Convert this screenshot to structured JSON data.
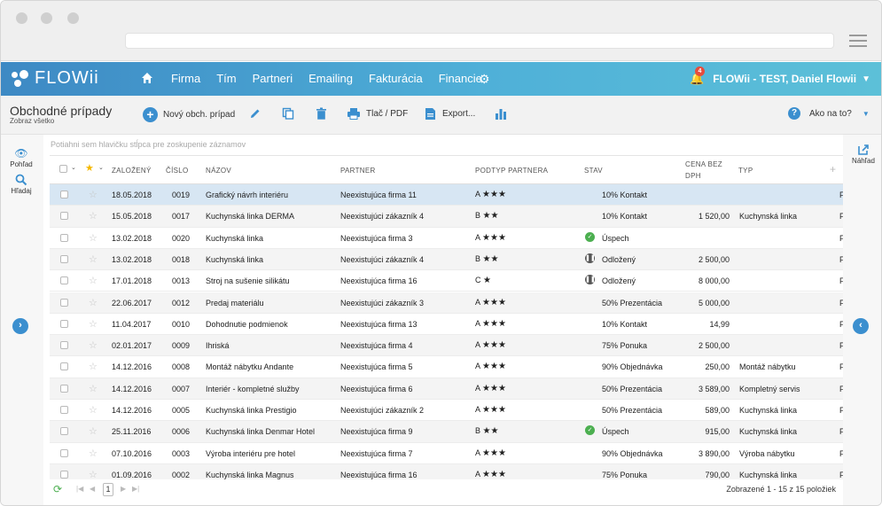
{
  "app": {
    "logo_text": "FLOWii",
    "nav_items": [
      "Firma",
      "Tím",
      "Partneri",
      "Emailing",
      "Fakturácia",
      "Financie"
    ],
    "notification_count": "4",
    "user_label": "FLOWii - TEST, Daniel Flowii",
    "brand_color": "#3d89c4"
  },
  "toolbar": {
    "title": "Obchodné prípady",
    "subtitle": "Zobraz všetko",
    "new_label": "Nový obch. prípad",
    "print_label": "Tlač / PDF",
    "export_label": "Export...",
    "help_label": "Ako na to?"
  },
  "left_panel": {
    "view_label": "Pohľad",
    "search_label": "Hľadaj"
  },
  "right_panel": {
    "preview_label": "Náhľad"
  },
  "grid": {
    "group_hint": "Potiahni sem hlavičku stĺpca pre zoskupenie záznamov",
    "headers": {
      "created": "ZALOŽENÝ",
      "number": "ČÍSLO",
      "name": "NÁZOV",
      "partner": "PARTNER",
      "subtype": "PODTYP PARTNERA",
      "status": "STAV",
      "price_1": "CENA BEZ",
      "price_2": "DPH",
      "type": "TYP"
    },
    "rows": [
      {
        "date": "18.05.2018",
        "num": "0019",
        "name": "Grafický návrh interiéru",
        "partner": "Neexistujúca firma 11",
        "grade": "A",
        "stars": "★★★",
        "state_icon": "",
        "state": "10% Kontakt",
        "price": "",
        "type": "",
        "selected": true
      },
      {
        "date": "15.05.2018",
        "num": "0017",
        "name": "Kuchynská linka DERMA",
        "partner": "Neexistujúci zákazník 4",
        "grade": "B",
        "stars": "★★",
        "state_icon": "",
        "state": "10% Kontakt",
        "price": "1 520,00",
        "type": "Kuchynská linka"
      },
      {
        "date": "13.02.2018",
        "num": "0020",
        "name": "Kuchynská linka",
        "partner": "Neexistujúca firma 3",
        "grade": "A",
        "stars": "★★★",
        "state_icon": "ok",
        "state": "Úspech",
        "price": "",
        "type": ""
      },
      {
        "date": "13.02.2018",
        "num": "0018",
        "name": "Kuchynská linka",
        "partner": "Neexistujúci zákazník 4",
        "grade": "B",
        "stars": "★★",
        "state_icon": "pause",
        "state": "Odložený",
        "price": "2 500,00",
        "type": ""
      },
      {
        "date": "17.01.2018",
        "num": "0013",
        "name": "Stroj na sušenie silikátu",
        "partner": "Neexistujúca firma 16",
        "grade": "C",
        "stars": "★",
        "state_icon": "pause",
        "state": "Odložený",
        "price": "8 000,00",
        "type": ""
      },
      {
        "date": "22.06.2017",
        "num": "0012",
        "name": "Predaj materiálu",
        "partner": "Neexistujúci zákazník 3",
        "grade": "A",
        "stars": "★★★",
        "state_icon": "",
        "state": "50% Prezentácia",
        "price": "5 000,00",
        "type": ""
      },
      {
        "date": "11.04.2017",
        "num": "0010",
        "name": "Dohodnutie podmienok",
        "partner": "Neexistujúca firma 13",
        "grade": "A",
        "stars": "★★★",
        "state_icon": "",
        "state": "10% Kontakt",
        "price": "14,99",
        "type": ""
      },
      {
        "date": "02.01.2017",
        "num": "0009",
        "name": "Ihriská",
        "partner": "Neexistujúca firma 4",
        "grade": "A",
        "stars": "★★★",
        "state_icon": "",
        "state": "75% Ponuka",
        "price": "2 500,00",
        "type": ""
      },
      {
        "date": "14.12.2016",
        "num": "0008",
        "name": "Montáž nábytku Andante",
        "partner": "Neexistujúca firma 5",
        "grade": "A",
        "stars": "★★★",
        "state_icon": "",
        "state": "90% Objednávka",
        "price": "250,00",
        "type": "Montáž nábytku"
      },
      {
        "date": "14.12.2016",
        "num": "0007",
        "name": "Interiér - kompletné služby",
        "partner": "Neexistujúca firma 6",
        "grade": "A",
        "stars": "★★★",
        "state_icon": "",
        "state": "50% Prezentácia",
        "price": "3 589,00",
        "type": "Kompletný servis"
      },
      {
        "date": "14.12.2016",
        "num": "0005",
        "name": "Kuchynská linka Prestigio",
        "partner": "Neexistujúci zákazník 2",
        "grade": "A",
        "stars": "★★★",
        "state_icon": "",
        "state": "50% Prezentácia",
        "price": "589,00",
        "type": "Kuchynská linka"
      },
      {
        "date": "25.11.2016",
        "num": "0006",
        "name": "Kuchynská linka Denmar Hotel",
        "partner": "Neexistujúca firma 9",
        "grade": "B",
        "stars": "★★",
        "state_icon": "ok",
        "state": "Úspech",
        "price": "915,00",
        "type": "Kuchynská linka"
      },
      {
        "date": "07.10.2016",
        "num": "0003",
        "name": "Výroba interiéru pre hotel",
        "partner": "Neexistujúca firma 7",
        "grade": "A",
        "stars": "★★★",
        "state_icon": "",
        "state": "90% Objednávka",
        "price": "3 890,00",
        "type": "Výroba nábytku"
      },
      {
        "date": "01.09.2016",
        "num": "0002",
        "name": "Kuchynská linka Magnus",
        "partner": "Neexistujúca firma 16",
        "grade": "A",
        "stars": "★★★",
        "state_icon": "",
        "state": "75% Ponuka",
        "price": "790,00",
        "type": "Kuchynská linka"
      }
    ],
    "truncated_char": "F"
  },
  "pager": {
    "page": "1",
    "info": "Zobrazené 1 - 15 z 15 položiek"
  }
}
